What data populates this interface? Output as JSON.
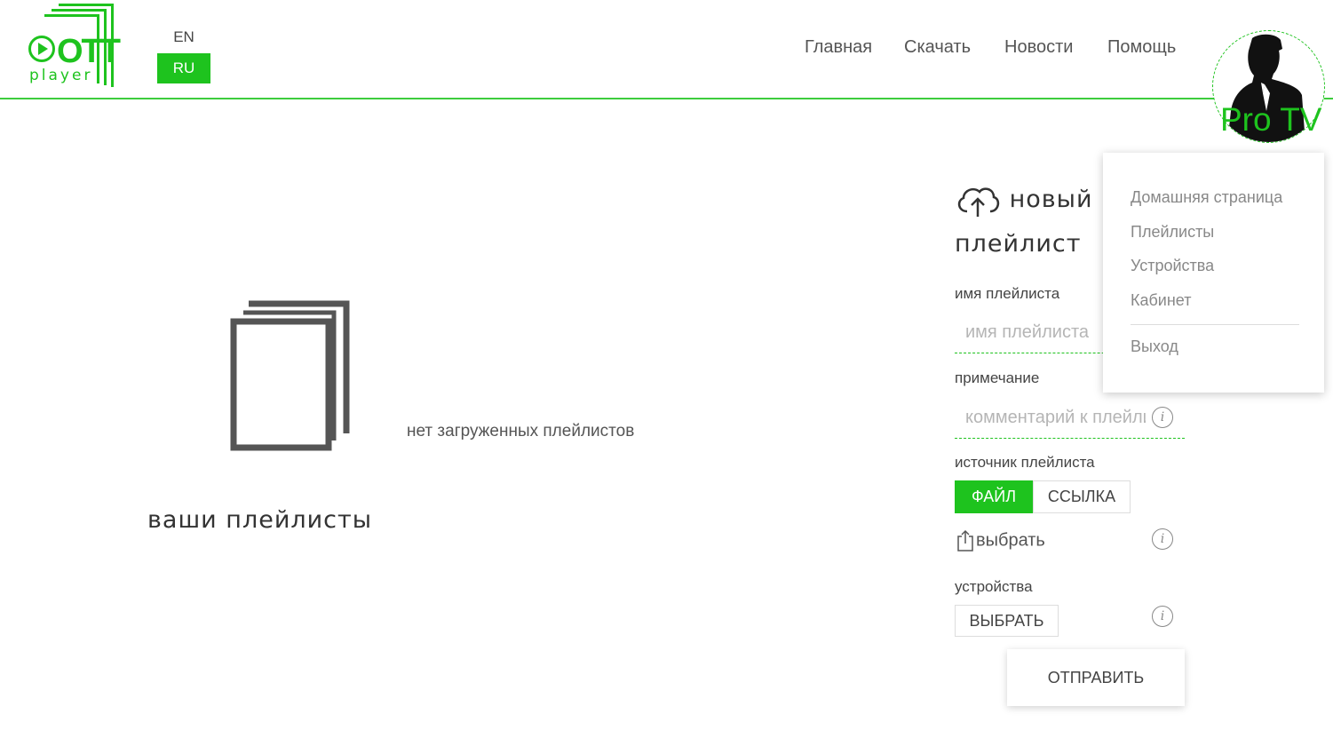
{
  "brand": {
    "logo_text": "OTT",
    "logo_sub": "player",
    "accent_color": "#1ec31e"
  },
  "language": {
    "options": [
      "EN",
      "RU"
    ],
    "selected": "RU"
  },
  "nav": {
    "items": [
      "Главная",
      "Скачать",
      "Новости",
      "Помощь"
    ]
  },
  "user": {
    "name": "Pro TV",
    "avatar_icon": "user-silhouette-icon"
  },
  "playlists": {
    "empty_text": "нет загруженных плейлистов",
    "title": "ваши плейлисты",
    "empty_icon": "documents-icon"
  },
  "new_playlist": {
    "title_line1": "новый",
    "title_line2": "плейлист",
    "title_icon": "cloud-upload-icon",
    "name_label": "имя плейлиста",
    "name_placeholder": "имя плейлиста",
    "name_value": "",
    "note_label": "примечание",
    "note_placeholder": "комментарий к плейлисту",
    "note_value": "",
    "source_label": "источник плейлиста",
    "source_options": [
      "ФАЙЛ",
      "ССЫЛКА"
    ],
    "source_selected": "ФАЙЛ",
    "choose_label": "выбрать",
    "devices_label": "устройства",
    "devices_button": "ВЫБРАТЬ",
    "submit_button": "ОТПРАВИТЬ"
  },
  "user_menu": {
    "items": [
      "Домашняя страница",
      "Плейлисты",
      "Устройства",
      "Кабинет"
    ],
    "logout": "Выход"
  }
}
